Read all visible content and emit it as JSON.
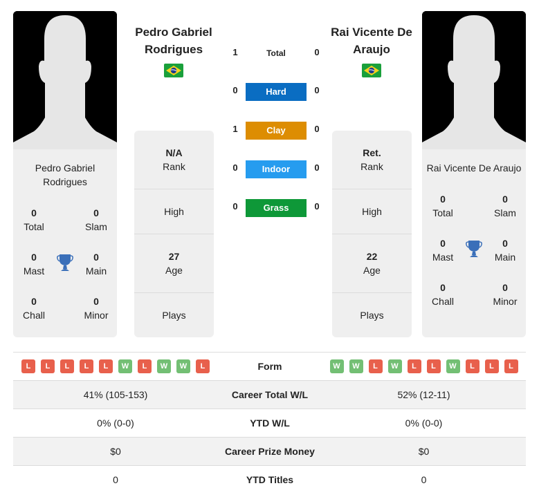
{
  "colors": {
    "hard": "#0a6dc2",
    "clay": "#dd8d02",
    "indoor": "#269cef",
    "grass": "#0e9838",
    "win": "#73bf74",
    "loss": "#e8604c",
    "trophy": "#3a6fb9"
  },
  "player1": {
    "name": "Pedro Gabriel Rodrigues",
    "country_flag": "brazil-flag",
    "titles": {
      "total": {
        "value": "0",
        "label": "Total"
      },
      "slam": {
        "value": "0",
        "label": "Slam"
      },
      "mast": {
        "value": "0",
        "label": "Mast"
      },
      "main": {
        "value": "0",
        "label": "Main"
      },
      "chall": {
        "value": "0",
        "label": "Chall"
      },
      "minor": {
        "value": "0",
        "label": "Minor"
      }
    },
    "rank": {
      "value": "N/A",
      "label": "Rank"
    },
    "high": {
      "label": "High"
    },
    "age": {
      "value": "27",
      "label": "Age"
    },
    "plays": {
      "label": "Plays"
    },
    "form": [
      "L",
      "L",
      "L",
      "L",
      "L",
      "W",
      "L",
      "W",
      "W",
      "L"
    ],
    "career_wl": "41% (105-153)",
    "ytd_wl": "0% (0-0)",
    "prize_money": "$0",
    "ytd_titles": "0"
  },
  "player2": {
    "name": "Rai Vicente De Araujo",
    "country_flag": "brazil-flag",
    "titles": {
      "total": {
        "value": "0",
        "label": "Total"
      },
      "slam": {
        "value": "0",
        "label": "Slam"
      },
      "mast": {
        "value": "0",
        "label": "Mast"
      },
      "main": {
        "value": "0",
        "label": "Main"
      },
      "chall": {
        "value": "0",
        "label": "Chall"
      },
      "minor": {
        "value": "0",
        "label": "Minor"
      }
    },
    "rank": {
      "value": "Ret.",
      "label": "Rank"
    },
    "high": {
      "label": "High"
    },
    "age": {
      "value": "22",
      "label": "Age"
    },
    "plays": {
      "label": "Plays"
    },
    "form": [
      "W",
      "W",
      "L",
      "W",
      "L",
      "L",
      "W",
      "L",
      "L",
      "L"
    ],
    "career_wl": "52% (12-11)",
    "ytd_wl": "0% (0-0)",
    "prize_money": "$0",
    "ytd_titles": "0"
  },
  "h2h": {
    "total": {
      "label": "Total",
      "p1": "1",
      "p2": "0"
    },
    "hard": {
      "label": "Hard",
      "p1": "0",
      "p2": "0"
    },
    "clay": {
      "label": "Clay",
      "p1": "1",
      "p2": "0"
    },
    "indoor": {
      "label": "Indoor",
      "p1": "0",
      "p2": "0"
    },
    "grass": {
      "label": "Grass",
      "p1": "0",
      "p2": "0"
    }
  },
  "comparison": {
    "form_label": "Form",
    "career_wl_label": "Career Total W/L",
    "ytd_wl_label": "YTD W/L",
    "prize_label": "Career Prize Money",
    "ytd_titles_label": "YTD Titles"
  }
}
